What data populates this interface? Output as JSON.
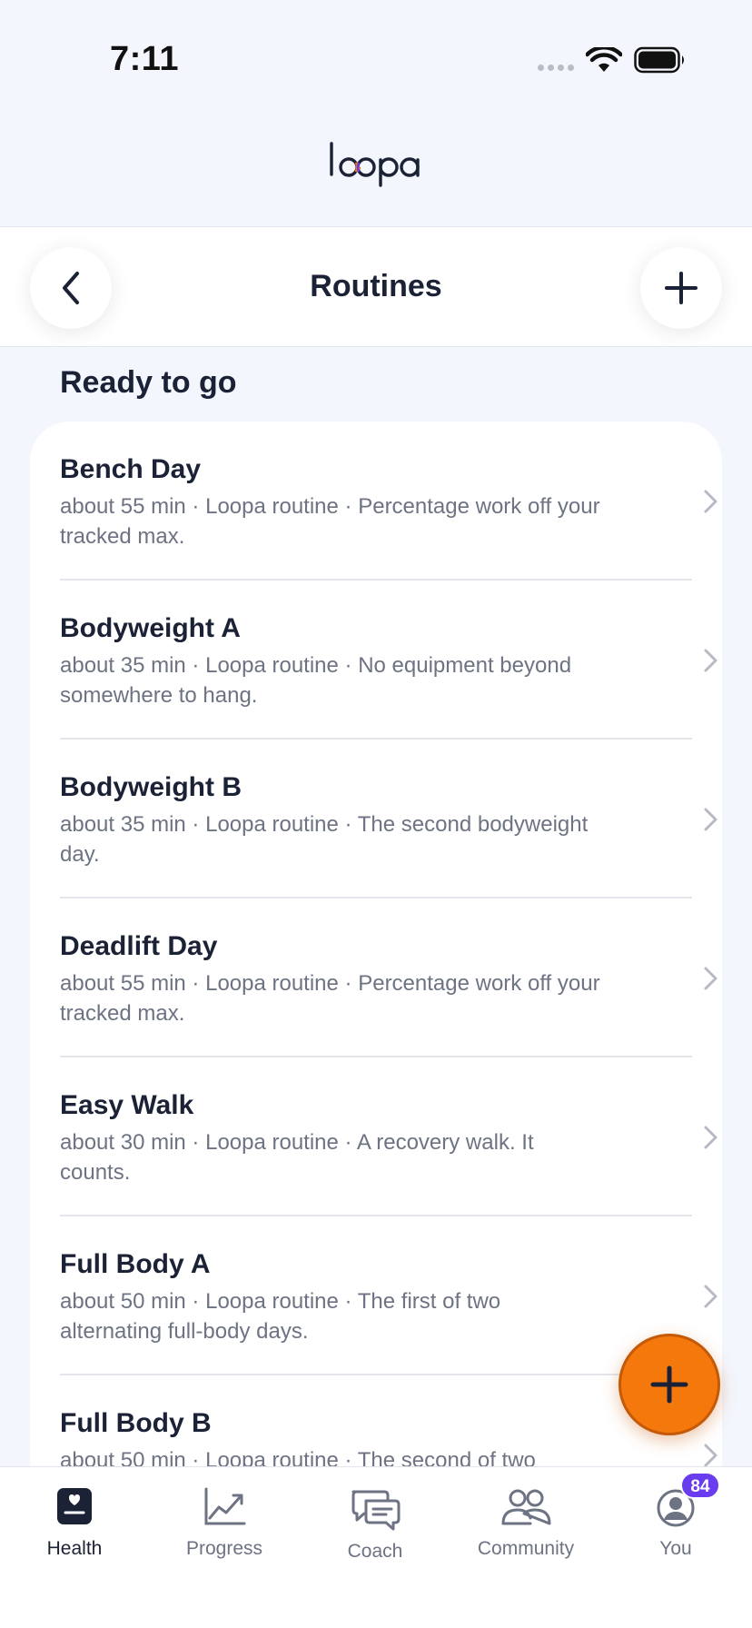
{
  "status_bar": {
    "time": "7:11"
  },
  "header": {
    "logo_text": "loopa",
    "title": "Routines"
  },
  "section": {
    "title": "Ready to go"
  },
  "routines": [
    {
      "title": "Bench Day",
      "subtitle": "about 55 min · Loopa routine · Percentage work off your tracked max."
    },
    {
      "title": "Bodyweight A",
      "subtitle": "about 35 min · Loopa routine · No equipment beyond somewhere to hang."
    },
    {
      "title": "Bodyweight B",
      "subtitle": "about 35 min · Loopa routine · The second bodyweight day."
    },
    {
      "title": "Deadlift Day",
      "subtitle": "about 55 min · Loopa routine · Percentage work off your tracked max."
    },
    {
      "title": "Easy Walk",
      "subtitle": "about 30 min · Loopa routine · A recovery walk. It counts."
    },
    {
      "title": "Full Body A",
      "subtitle": "about 50 min · Loopa routine · The first of two alternating full-body days."
    },
    {
      "title": "Full Body B",
      "subtitle": "about 50 min · Loopa routine · The second of two"
    }
  ],
  "tab_bar": {
    "tabs": [
      {
        "label": "Health",
        "icon": "health-icon",
        "active": true
      },
      {
        "label": "Progress",
        "icon": "progress-chart-icon",
        "active": false
      },
      {
        "label": "Coach",
        "icon": "chat-bubbles-icon",
        "active": false
      },
      {
        "label": "Community",
        "icon": "people-icon",
        "active": false
      },
      {
        "label": "You",
        "icon": "profile-icon",
        "active": false
      }
    ],
    "you_badge": "84"
  },
  "colors": {
    "accent_orange": "#f5780c",
    "badge_purple": "#6a3cf0",
    "text_primary": "#1b2236",
    "text_secondary": "#6d7383",
    "background": "#f3f6fd"
  }
}
